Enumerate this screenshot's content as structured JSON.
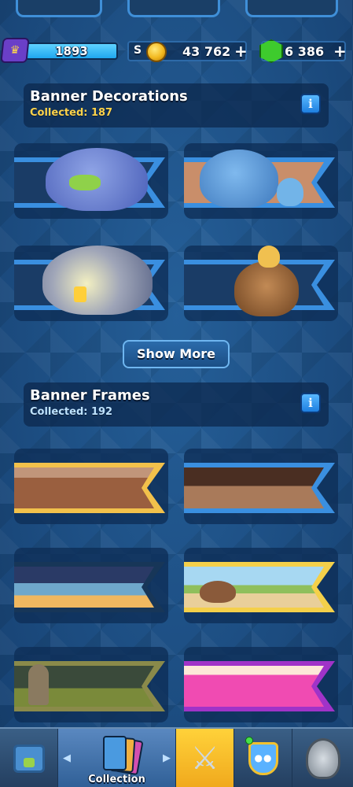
{
  "hud": {
    "xp_value": "1893",
    "gold_partial": "S",
    "gold_value": "43 762",
    "gold_plus": "+",
    "gem_value": "6 386",
    "gem_plus": "+"
  },
  "sections": [
    {
      "title": "Banner Decorations",
      "subtitle": "Collected: 187",
      "info_icon": "i"
    },
    {
      "title": "Banner Frames",
      "subtitle": "Collected: 192",
      "info_icon": "i"
    }
  ],
  "show_more_label": "Show More",
  "nav": {
    "collection_label": "Collection",
    "left_arrow": "◀",
    "right_arrow": "▶"
  },
  "colors": {
    "accent_gold": "#ffd34a",
    "info_blue": "#1e7fe0",
    "background": "#1d5388"
  }
}
